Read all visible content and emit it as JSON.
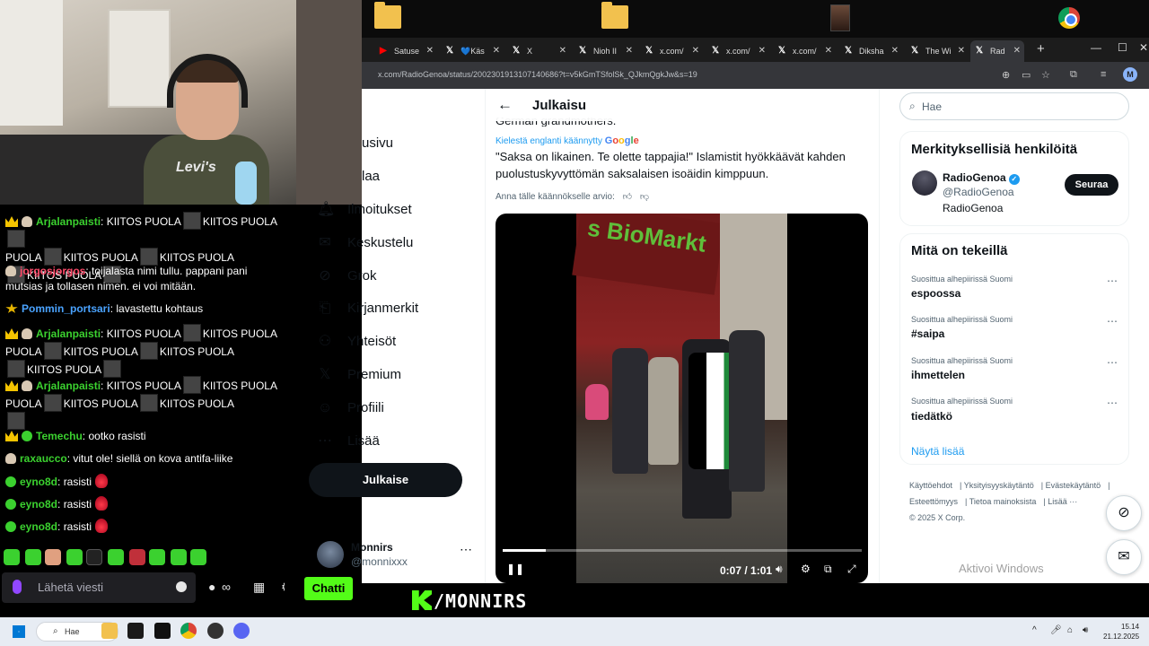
{
  "desktop": {
    "icons": [
      "folder",
      "folder",
      "image",
      "chrome"
    ]
  },
  "webcam": {
    "shirt_logo": "Levi's"
  },
  "chat": {
    "messages": [
      {
        "user": "Arjalanpaisti",
        "color": "#3bd12f",
        "text": "KIITOS PUOLA",
        "badges": [
          "crown",
          "ghost"
        ]
      },
      {
        "user": "jorgosjorgos",
        "color": "#ff4a6a",
        "text": "toijalasta nimi tullu. pappani pani mutsias ja tollasen nimen. ei voi mitään.",
        "badges": [
          "ghost"
        ]
      },
      {
        "user": "Pommin_portsari",
        "color": "#4aa3ff",
        "text": "lavastettu kohtaus",
        "badges": [
          "star"
        ]
      },
      {
        "user": "Arjalanpaisti",
        "color": "#3bd12f",
        "text": "KIITOS PUOLA",
        "badges": [
          "crown",
          "ghost"
        ]
      },
      {
        "user": "Arjalanpaisti",
        "color": "#3bd12f",
        "text": "KIITOS PUOLA",
        "badges": [
          "crown",
          "ghost"
        ]
      },
      {
        "user": "Temechu",
        "color": "#3bd12f",
        "text": "ootko rasisti",
        "badges": [
          "crown",
          "frog"
        ]
      },
      {
        "user": "raxaucco",
        "color": "#3bd12f",
        "text": "vitut ole! siellä on kova antifa-liike",
        "badges": [
          "ghost"
        ]
      },
      {
        "user": "eyno8d",
        "color": "#3bd12f",
        "text": "rasisti",
        "badges": [
          "frog"
        ]
      },
      {
        "user": "eyno8d",
        "color": "#3bd12f",
        "text": "rasisti",
        "badges": [
          "frog"
        ]
      },
      {
        "user": "eyno8d",
        "color": "#3bd12f",
        "text": "rasisti",
        "badges": [
          "frog"
        ]
      }
    ],
    "input_placeholder": "Lähetä viesti",
    "send_label": "Chatti",
    "kiitos": "KIITOS PUOLA",
    "puola": "PUOLA",
    "infinity": "∞"
  },
  "browser": {
    "tabs": [
      {
        "label": "Satuse",
        "icon": "youtube"
      },
      {
        "label": "💙Käs",
        "icon": "x"
      },
      {
        "label": "X",
        "icon": "x"
      },
      {
        "label": "Nioh II",
        "icon": "x"
      },
      {
        "label": "x.com/",
        "icon": "x"
      },
      {
        "label": "x.com/",
        "icon": "x"
      },
      {
        "label": "x.com/",
        "icon": "x"
      },
      {
        "label": "Diksha",
        "icon": "x"
      },
      {
        "label": "The Wi",
        "icon": "x"
      },
      {
        "label": "Rad",
        "icon": "x",
        "active": true
      }
    ],
    "url": "x.com/RadioGenoa/status/2002301913107140686?t=v5kGmTSfolSk_QJkmQgkJw&s=19",
    "profile_initial": "M"
  },
  "x": {
    "nav": [
      {
        "label": "usivu",
        "icon": "home-icon"
      },
      {
        "label": "laa",
        "icon": "explore-icon"
      },
      {
        "label": "Ilmoitukset",
        "icon": "bell-icon"
      },
      {
        "label": "Keskustelu",
        "icon": "mail-icon"
      },
      {
        "label": "Grok",
        "icon": "grok-icon"
      },
      {
        "label": "Kirjanmerkit",
        "icon": "bookmark-icon"
      },
      {
        "label": "Yhteisöt",
        "icon": "communities-icon"
      },
      {
        "label": "Premium",
        "icon": "x-logo-icon"
      },
      {
        "label": "Profiili",
        "icon": "profile-icon"
      },
      {
        "label": "Lisää",
        "icon": "more-icon"
      }
    ],
    "post_button": "Julkaise",
    "account": {
      "name": "Monnirs",
      "handle": "@monnixxx"
    },
    "header_title": "Julkaisu",
    "cut_text": "German grandmothers.",
    "translated_label": "Kielestä englanti käännytty",
    "google": [
      "G",
      "o",
      "o",
      "g",
      "l",
      "e"
    ],
    "tweet_text": "\"Saksa on likainen. Te olette tappajia!\" Islamistit hyökkäävät kahden puolustuskyvyttömän saksalaisen isoäidin kimppuun.",
    "rate_text": "Anna tälle käännökselle arvio:",
    "video": {
      "time": "0:07 / 1:01",
      "progress": 0.12,
      "sign_text": "s BioMarkt"
    },
    "search_placeholder": "Hae",
    "who_to_follow": {
      "title": "Merkityksellisiä henkilöitä",
      "name": "RadioGenoa",
      "handle": "@RadioGenoa",
      "bio": "RadioGenoa",
      "follow": "Seuraa"
    },
    "trends": {
      "title": "Mitä on tekeillä",
      "items": [
        {
          "context": "Suosittua alhepiirissä Suomi",
          "name": "espoossa"
        },
        {
          "context": "Suosittua alhepiirissä Suomi",
          "name": "#saipa"
        },
        {
          "context": "Suosittua alhepiirissä Suomi",
          "name": "ihmettelen"
        },
        {
          "context": "Suosittua alhepiirissä Suomi",
          "name": "tiedätkö"
        }
      ],
      "show_more": "Näytä lisää"
    },
    "footer": [
      "Käyttöehdot",
      "Yksityisyyskäytäntö",
      "Evästekäytäntö",
      "Esteettömyys",
      "Tietoa mainoksista",
      "Lisää ···",
      "© 2025 X Corp."
    ],
    "activate_windows": "Aktivoi Windows"
  },
  "banner": {
    "channel": "/MONNIRS"
  },
  "taskbar": {
    "search_label": "Hae",
    "time": "15.14",
    "date": "21.12.2025"
  }
}
